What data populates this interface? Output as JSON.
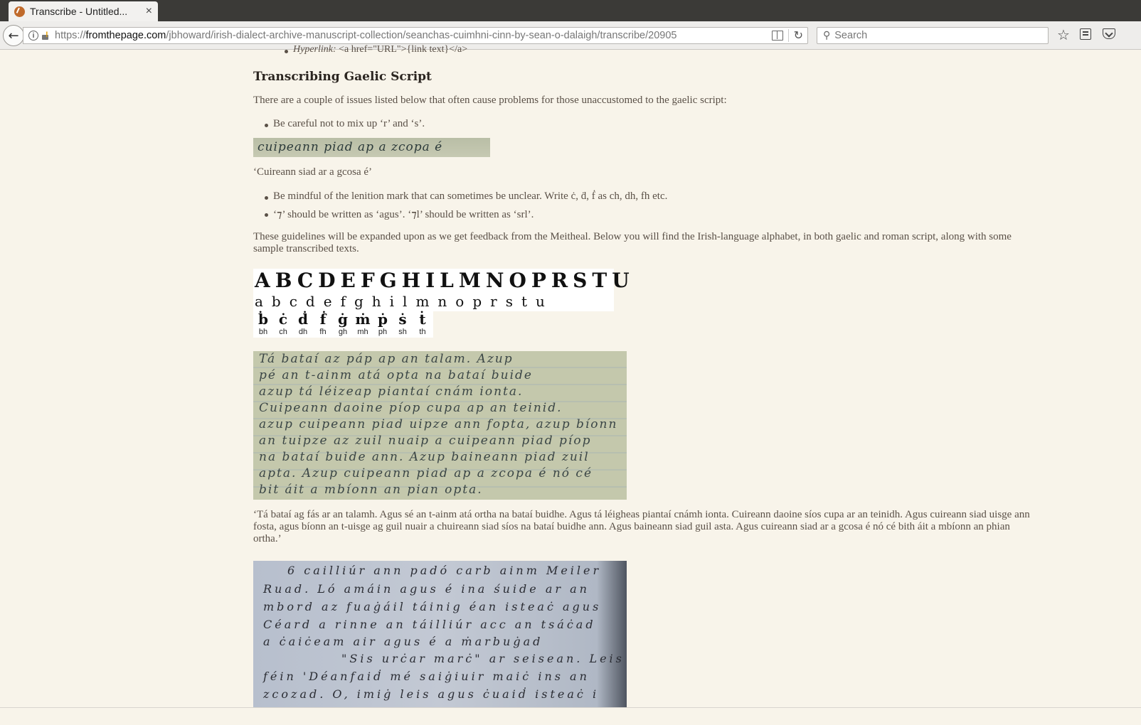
{
  "browser": {
    "tab_title": "Transcribe - Untitled...",
    "tab_close": "×",
    "url_prefix": "https://",
    "url_domain": "fromthepage.com",
    "url_path": "/jbhoward/irish-dialect-archive-manuscript-collection/seanchas-cuimhni-cinn-by-sean-o-dalaigh/transcribe/20905",
    "search_placeholder": "Search"
  },
  "page": {
    "hyperlink_label": "Hyperlink:",
    "hyperlink_code": " <a href=\"URL\">{link text}</a>",
    "heading": "Transcribing Gaelic Script",
    "intro": "There are a couple of issues listed below that often cause problems for those unaccustomed to the gaelic script:",
    "bullet_rs": "Be careful not to mix up ‘r’ and ‘s’.",
    "rs_image_text": "cuipeann piad ap a zcopa é",
    "caption_rs": "‘Cuireann siad ar a gcosa é’",
    "bullet_lenition": "Be mindful of the lenition mark that can sometimes be unclear. Write ċ, ḋ, ḟ as ch, dh, fh etc.",
    "bullet_agus": "‘⁊’ should be written as ‘agus’. ‘⁊l’ should be written as ‘srl’.",
    "guidelines": "These guidelines will be expanded upon as we get feedback from the Meitheal. Below you will find the Irish-language alphabet, in both gaelic and roman script, along with some sample transcribed texts.",
    "alphabet_gaelic_upper": "ABCDEFGHILMNOPRSTU",
    "alphabet_gaelic_lower": "abcdefghilmnoprstu",
    "lenition": [
      {
        "glyph": "ḃ",
        "roman": "bh"
      },
      {
        "glyph": "ċ",
        "roman": "ch"
      },
      {
        "glyph": "ḋ",
        "roman": "dh"
      },
      {
        "glyph": "ḟ",
        "roman": "fh"
      },
      {
        "glyph": "ġ",
        "roman": "gh"
      },
      {
        "glyph": "ṁ",
        "roman": "mh"
      },
      {
        "glyph": "ṗ",
        "roman": "ph"
      },
      {
        "glyph": "ṡ",
        "roman": "sh"
      },
      {
        "glyph": "ṫ",
        "roman": "th"
      }
    ],
    "manuscript1_lines": [
      "Tá bataí az páp ap an talam. Azup",
      "pé an t-ainm atá opta na bataí buide",
      "azup tá léizeap piantaí cnám ionta.",
      "Cuipeann daoine píop cupa ap an teinid.",
      "azup cuipeann piad uipze ann fopta, azup bíonn",
      "an tuipze az zuil nuaip a cuipeann piad píop",
      "na bataí buide ann. Azup baineann piad zuil",
      "apta. Azup cuipeann piad ap a zcopa é nó cé",
      "bit áit a mbíonn an pian opta."
    ],
    "caption_manuscript1": "‘Tá bataí ag fás ar an talamh. Agus sé an t-ainm atá ortha na bataí buidhe. Agus tá léigheas piantaí cnámh ionta. Cuireann daoine síos cupa ar an teinidh. Agus cuireann siad uisge ann fosta, agus bíonn an t-uisge ag guil nuair a chuireann siad síos na bataí buidhe ann. Agus baineann siad guil asta. Agus cuireann siad ar a gcosa é nó cé bith áit a mbíonn an phian ortha.’",
    "manuscript2_lines": [
      "6 cailliúr ann padó carb ainm Meiler",
      "Ruad. Ló amáin agus é ina śuide ar an",
      "mbord az fuaġáil táinig éan isteaċ agus",
      "Céard a rinne an táilliúr acc an tsáċad",
      "a ċaiċeam air agus é a ṁarbuġad",
      "\"Sis urċar marċ\" ar seisean. Leis",
      "féin 'Déanfaiḋ mé saiġiuir maiċ ins an",
      "zcozad. O, imiġ leis agus ċuaiḋ isteaċ i"
    ]
  }
}
